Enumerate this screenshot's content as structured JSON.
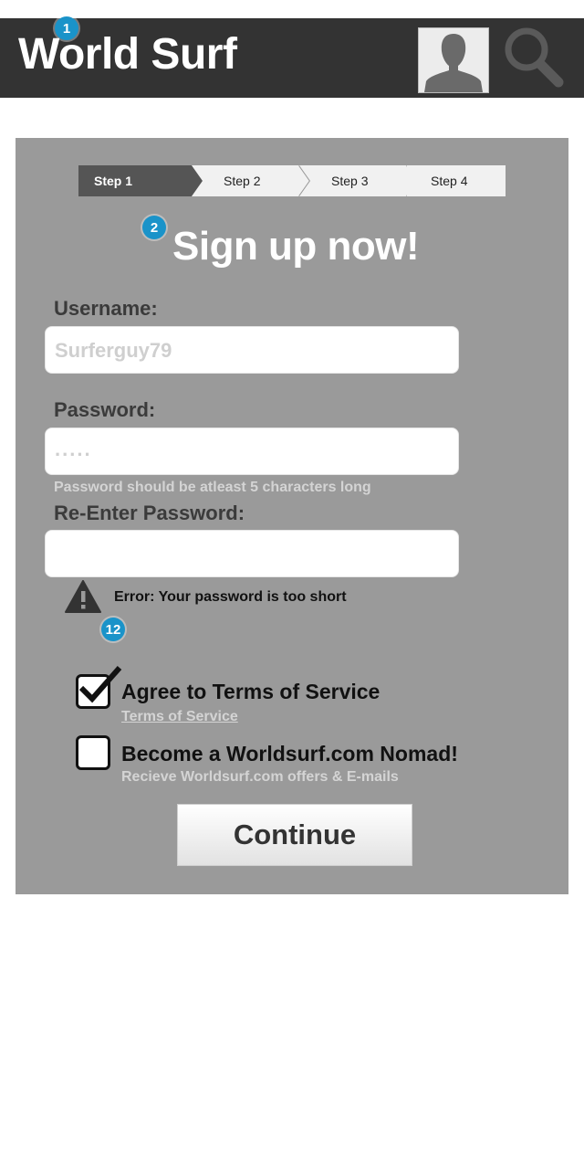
{
  "header": {
    "logo": "World Surf",
    "badge": "1"
  },
  "steps": [
    "Step 1",
    "Step 2",
    "Step 3",
    "Step 4"
  ],
  "form": {
    "title_badge": "2",
    "title": "Sign up now!",
    "username_label": "Username:",
    "username_value": "Surferguy79",
    "password_label": "Password:",
    "password_value": ".....",
    "password_hint": "Password should be atleast 5 characters long",
    "reenter_label": "Re-Enter Password:",
    "reenter_value": "",
    "error_text": "Error: Your password is too short",
    "error_badge": "12",
    "terms_label": "Agree to Terms of Service",
    "terms_link": "Terms of Service",
    "terms_checked": true,
    "nomad_label": "Become a Worldsurf.com Nomad!",
    "nomad_sub": "Recieve Worldsurf.com offers & E-mails",
    "nomad_checked": false,
    "continue_label": "Continue"
  },
  "colors": {
    "header_bg": "#333333",
    "card_bg": "#9a9a9a",
    "badge": "#1a93c9",
    "active_step": "#555555"
  },
  "icons": {
    "avatar": "user-silhouette-icon",
    "search": "magnifier-icon",
    "warning": "warning-triangle-icon",
    "check": "checkmark-icon"
  }
}
